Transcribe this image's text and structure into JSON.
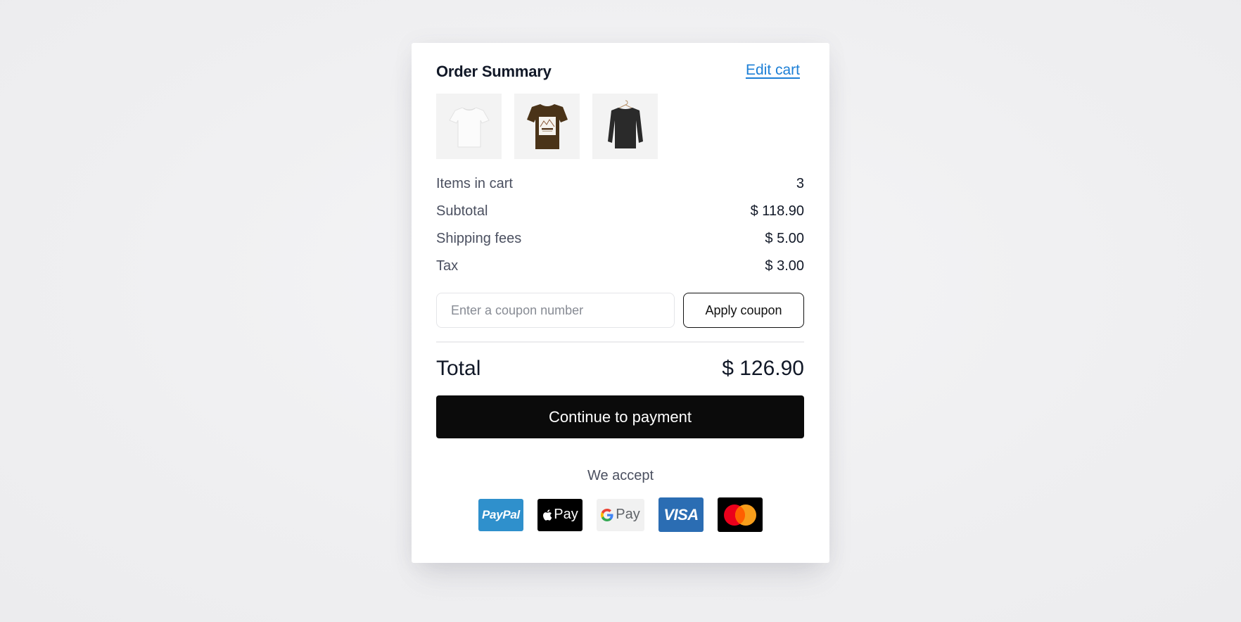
{
  "header": {
    "title": "Order Summary",
    "edit_cart_label": "Edit cart"
  },
  "thumbnails": [
    {
      "name": "white-tshirt",
      "color": "#f7f7f7"
    },
    {
      "name": "brown-graphic-tshirt",
      "color": "#4a3318"
    },
    {
      "name": "black-sweatshirt",
      "color": "#2a2a2a"
    }
  ],
  "summary": {
    "rows": [
      {
        "label": "Items in cart",
        "value": "3"
      },
      {
        "label": "Subtotal",
        "value": "$ 118.90"
      },
      {
        "label": "Shipping fees",
        "value": "$ 5.00"
      },
      {
        "label": "Tax",
        "value": "$ 3.00"
      }
    ]
  },
  "coupon": {
    "placeholder": "Enter a coupon number",
    "value": "",
    "apply_label": "Apply coupon"
  },
  "total": {
    "label": "Total",
    "value": "$ 126.90"
  },
  "checkout": {
    "button_label": "Continue to payment"
  },
  "payment": {
    "heading": "We accept",
    "methods": [
      {
        "name": "paypal",
        "label": "PayPal",
        "color": "#2f90cc"
      },
      {
        "name": "apple-pay",
        "label": "Pay",
        "color": "#000000"
      },
      {
        "name": "google-pay",
        "label": "Pay",
        "color": "#f1f1f1"
      },
      {
        "name": "visa",
        "label": "VISA",
        "color": "#2b6db3"
      },
      {
        "name": "mastercard",
        "label": "",
        "color": "#000000"
      }
    ]
  },
  "colors": {
    "link": "#1c7fd6",
    "primary_button": "#0b0b0b",
    "mastercard_red": "#eb001b",
    "mastercard_orange": "#f79e1b"
  }
}
